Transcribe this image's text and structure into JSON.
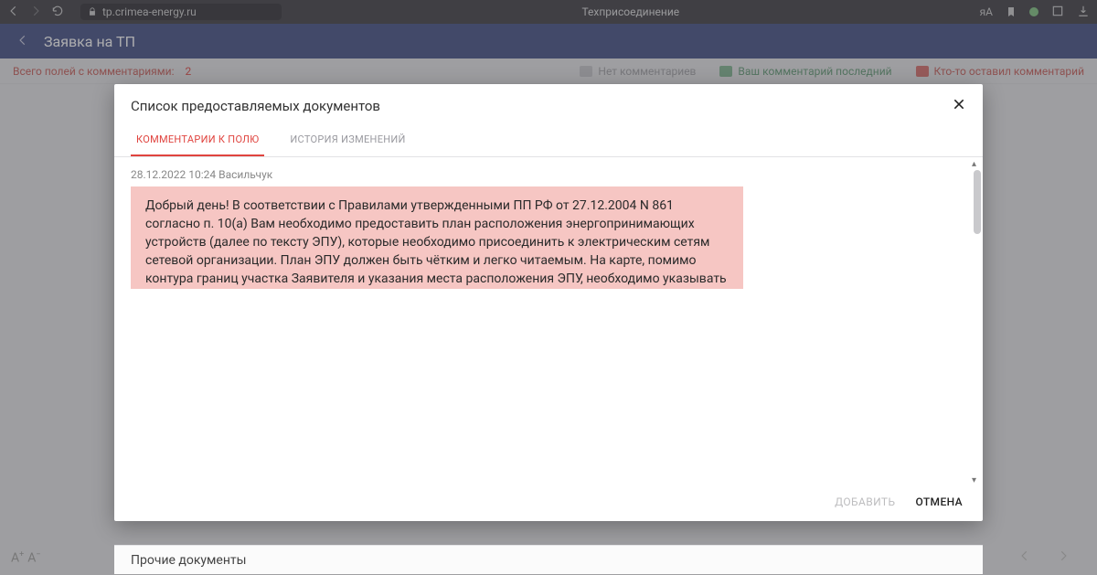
{
  "browser": {
    "url": "tp.crimea-energy.ru",
    "tab_title": "Техприсоединение"
  },
  "header": {
    "title": "Заявка на ТП"
  },
  "legend": {
    "total_label": "Всего полей с комментариями:",
    "total_count": "2",
    "none": "Нет комментариев",
    "yours": "Ваш комментарий последний",
    "other": "Кто-то оставил комментарий"
  },
  "dialog": {
    "title": "Список предоставляемых документов",
    "tabs": {
      "comments": "Комментарии к полю",
      "history": "История изменений"
    },
    "comment": {
      "meta": "28.12.2022 10:24 Васильчук",
      "text": "Добрый день! В соответствии с Правилами утвержденными ПП РФ от 27.12.2004 N 861 согласно п. 10(а) Вам необходимо предоставить план расположения энергопринимающих устройств (далее по тексту ЭПУ), которые необходимо присоединить к электрическим сетям сетевой организации. План ЭПУ должен быть чётким и легко читаемым. На карте, помимо контура границ участка Заявителя и указания места расположения ЭПУ, необходимо указывать (одно) место расположения ЭПУ и от него сноску на место расположения ЭПУ, также должны быть изображены географические объекты (ориентиры): дороги, промышленные объекты, объекты инфраструктуры и т.п., имеющие адресные ориентиры (указатели),"
    },
    "actions": {
      "add": "Добавить",
      "cancel": "Отмена"
    }
  },
  "bottom": {
    "section_title": "Прочие документы"
  }
}
